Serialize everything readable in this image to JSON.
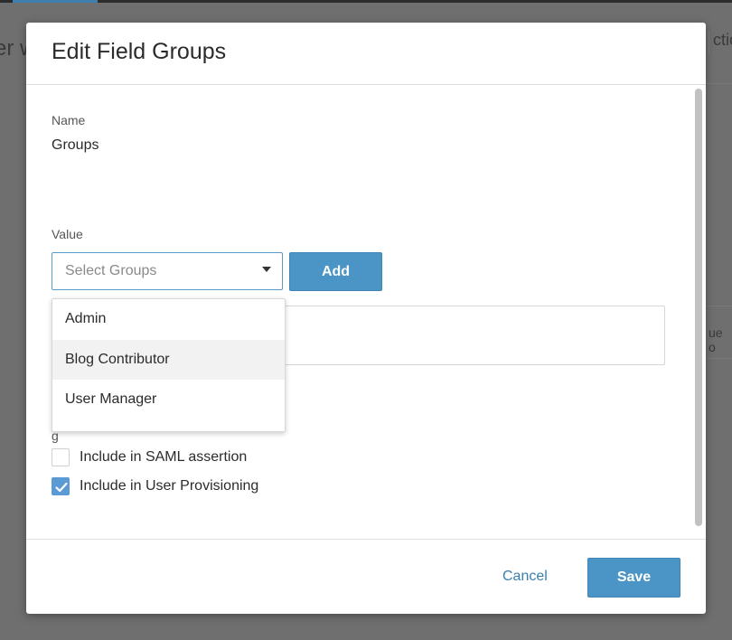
{
  "background": {
    "left_fragment": "er w",
    "right_fragment": "ctio",
    "right_fragment_2": "ue o"
  },
  "modal": {
    "title": "Edit Field Groups",
    "name_label": "Name",
    "name_value": "Groups",
    "value_label": "Value",
    "select": {
      "placeholder": "Select Groups"
    },
    "add_label": "Add",
    "dropdown_options": [
      "Admin",
      "Blog Contributor",
      "User Manager"
    ],
    "hovered_option": "Blog Contributor",
    "partial_label": "g",
    "checkboxes": [
      {
        "label": "Include in SAML assertion",
        "checked": false
      },
      {
        "label": "Include in User Provisioning",
        "checked": true
      }
    ],
    "cancel_label": "Cancel",
    "save_label": "Save"
  },
  "colors": {
    "accent": "#4a94c6",
    "link": "#3a7fb0",
    "checkbox_checked": "#5b9bd5"
  }
}
